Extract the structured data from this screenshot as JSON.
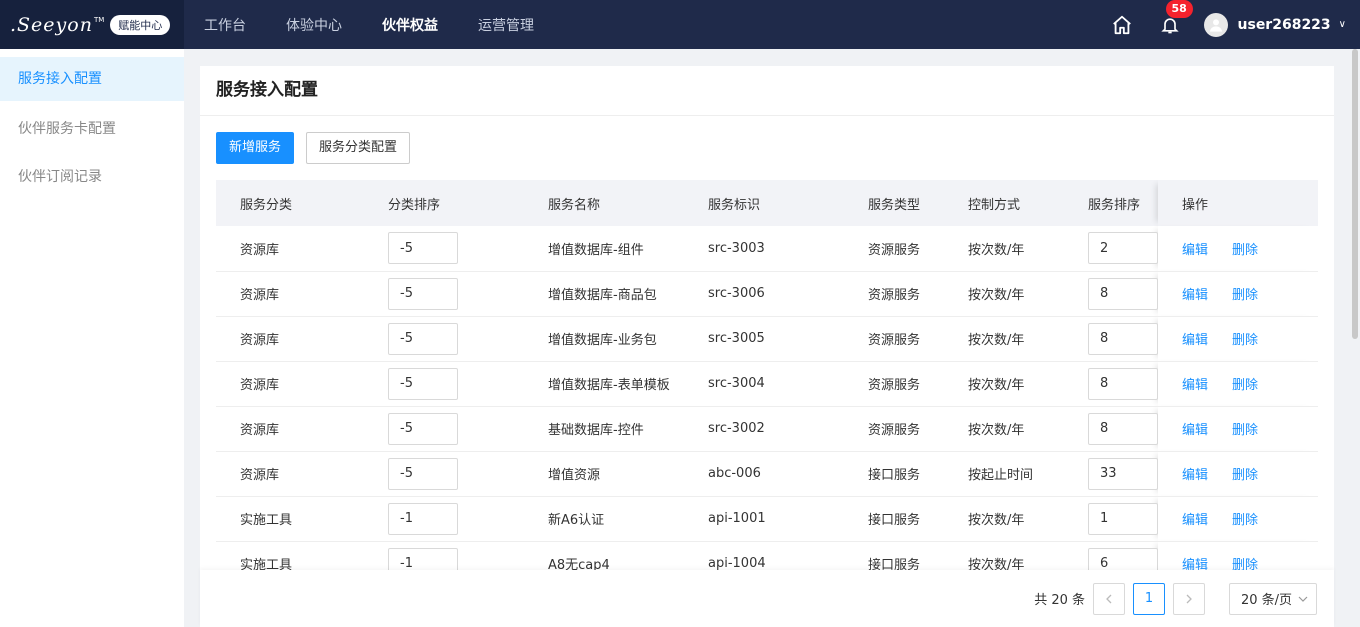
{
  "brand": {
    "logo_text": ".Seeyon",
    "tm": "TM",
    "badge": "赋能中心"
  },
  "nav": {
    "items": [
      "工作台",
      "体验中心",
      "伙伴权益",
      "运营管理"
    ],
    "active_index": 2
  },
  "header": {
    "notification_count": "58",
    "username": "user268223"
  },
  "sidebar": {
    "items": [
      "服务接入配置",
      "伙伴服务卡配置",
      "伙伴订阅记录"
    ],
    "active_index": 0
  },
  "page": {
    "title": "服务接入配置"
  },
  "toolbar": {
    "add_label": "新增服务",
    "category_config_label": "服务分类配置"
  },
  "table": {
    "headers": [
      "服务分类",
      "分类排序",
      "服务名称",
      "服务标识",
      "服务类型",
      "控制方式",
      "服务排序",
      "操作"
    ],
    "edit_label": "编辑",
    "delete_label": "删除",
    "rows": [
      {
        "category": "资源库",
        "cat_order": "-5",
        "name": "增值数据库-组件",
        "code": "src-3003",
        "type": "资源服务",
        "control": "按次数/年",
        "order": "2"
      },
      {
        "category": "资源库",
        "cat_order": "-5",
        "name": "增值数据库-商品包",
        "code": "src-3006",
        "type": "资源服务",
        "control": "按次数/年",
        "order": "8"
      },
      {
        "category": "资源库",
        "cat_order": "-5",
        "name": "增值数据库-业务包",
        "code": "src-3005",
        "type": "资源服务",
        "control": "按次数/年",
        "order": "8"
      },
      {
        "category": "资源库",
        "cat_order": "-5",
        "name": "增值数据库-表单模板",
        "code": "src-3004",
        "type": "资源服务",
        "control": "按次数/年",
        "order": "8"
      },
      {
        "category": "资源库",
        "cat_order": "-5",
        "name": "基础数据库-控件",
        "code": "src-3002",
        "type": "资源服务",
        "control": "按次数/年",
        "order": "8"
      },
      {
        "category": "资源库",
        "cat_order": "-5",
        "name": "增值资源",
        "code": "abc-006",
        "type": "接口服务",
        "control": "按起止时间",
        "order": "33"
      },
      {
        "category": "实施工具",
        "cat_order": "-1",
        "name": "新A6认证",
        "code": "api-1001",
        "type": "接口服务",
        "control": "按次数/年",
        "order": "1"
      },
      {
        "category": "实施工具",
        "cat_order": "-1",
        "name": "A8无cap4",
        "code": "api-1004",
        "type": "接口服务",
        "control": "按次数/年",
        "order": "6"
      }
    ]
  },
  "pagination": {
    "total": "共 20 条",
    "current_page": "1",
    "page_size": "20 条/页"
  },
  "colors": {
    "topbar": "#1f2a4a",
    "primary": "#1890ff",
    "badge": "#f5222d"
  },
  "icons": {
    "home": "home-icon",
    "bell": "bell-icon",
    "user": "user-avatar-icon"
  }
}
